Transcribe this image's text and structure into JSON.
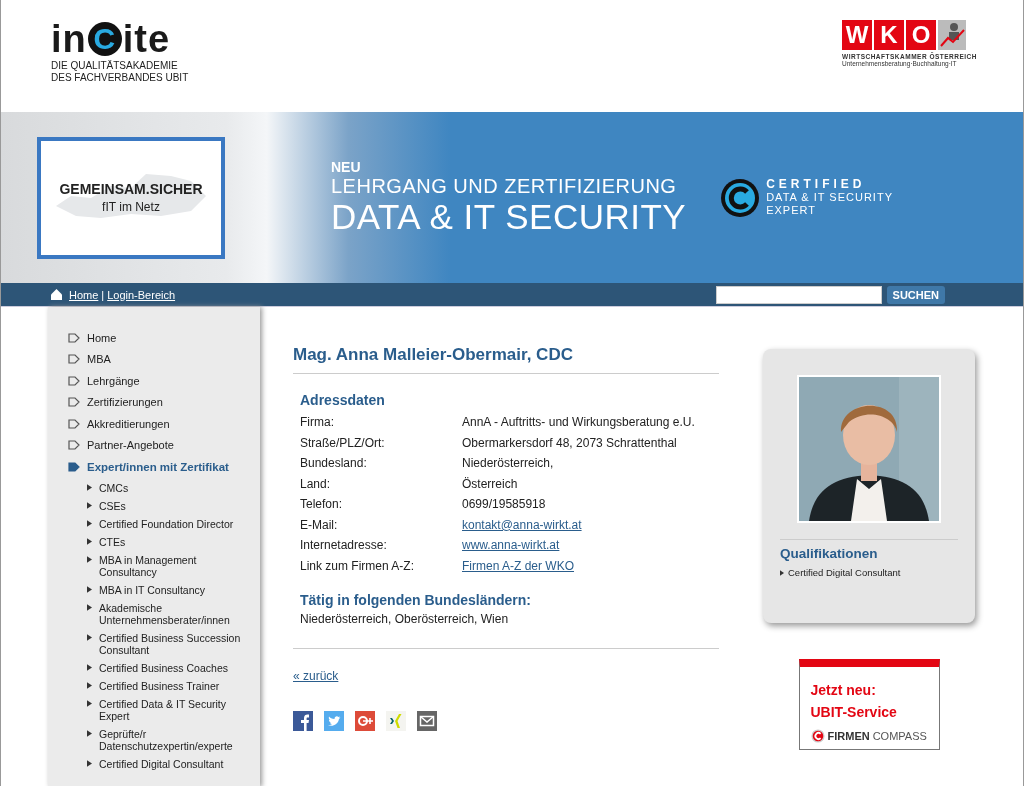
{
  "header": {
    "logo": {
      "parts": [
        "in",
        "C",
        "ite"
      ],
      "tagline": [
        "DIE QUALITÄTSAKADEMIE",
        "DES FACHVERBANDES UBIT"
      ]
    },
    "partner_logo": {
      "letters": [
        "W",
        "K",
        "O"
      ],
      "line1": "WIRTSCHAFTSKAMMER ÖSTERREICH",
      "line2": "Unternehmensberatung·Buchhaltung·IT"
    }
  },
  "banner": {
    "badge_title": "GEMEINSAM.SICHER",
    "badge_subtitle": "fIT im Netz",
    "kicker": "NEU",
    "subtitle": "LEHRGANG UND ZERTIFIZIERUNG",
    "title": "DATA & IT SECURITY",
    "cert": [
      "CERTIFIED",
      "DATA & IT SECURITY",
      "EXPERT"
    ]
  },
  "breadcrumb": {
    "links": [
      "Home",
      "Login-Bereich"
    ],
    "separator": "|"
  },
  "search": {
    "button": "SUCHEN"
  },
  "sidebar": {
    "items": [
      {
        "label": "Home",
        "selected": false
      },
      {
        "label": "MBA",
        "selected": false
      },
      {
        "label": "Lehrgänge",
        "selected": false
      },
      {
        "label": "Zertifizierungen",
        "selected": false
      },
      {
        "label": "Akkreditierungen",
        "selected": false
      },
      {
        "label": "Partner-Angebote",
        "selected": false
      },
      {
        "label": "Expert/innen mit Zertifikat",
        "selected": true,
        "children": [
          "CMCs",
          "CSEs",
          "Certified Foundation Director",
          "CTEs",
          "MBA in Management Consultancy",
          "MBA in IT Consultancy",
          "Akademische Unternehmensberater/innen",
          "Certified Business Succession Consultant",
          "Certified Business Coaches",
          "Certified Business Trainer",
          "Certified Data & IT Security Expert",
          "Geprüfte/r Datenschutzexpertin/experte",
          "Certified Digital Consultant"
        ]
      }
    ]
  },
  "profile": {
    "name": "Mag. Anna Malleier-Obermair, CDC",
    "section": "Adressdaten",
    "fields": [
      {
        "label": "Firma:",
        "value": "AnnA - Auftritts- und Wirkungsberatung e.U.",
        "kind": "text"
      },
      {
        "label": "Straße/PLZ/Ort:",
        "value": "Obermarkersdorf 48, 2073 Schrattenthal",
        "kind": "text"
      },
      {
        "label": "Bundesland:",
        "value": "Niederösterreich,",
        "kind": "text"
      },
      {
        "label": "Land:",
        "value": "Österreich",
        "kind": "text"
      },
      {
        "label": "Telefon:",
        "value": "0699/19585918",
        "kind": "text"
      },
      {
        "label": "E-Mail:",
        "value": "kontakt@anna-wirkt.at",
        "kind": "link"
      },
      {
        "label": "Internetadresse:",
        "value": "www.anna-wirkt.at",
        "kind": "link"
      },
      {
        "label": "Link zum Firmen A-Z:",
        "value": "Firmen A-Z der WKO",
        "kind": "link"
      }
    ],
    "regions_heading": "Tätig in folgenden Bundesländern:",
    "regions": "Niederösterreich, Oberösterreich, Wien",
    "back_link": "« zurück",
    "share": [
      {
        "kind": "facebook"
      },
      {
        "kind": "twitter"
      },
      {
        "kind": "googleplus"
      },
      {
        "kind": "xing"
      },
      {
        "kind": "email"
      }
    ]
  },
  "card": {
    "photo": {
      "kind": "picture"
    },
    "heading": "Qualifikationen",
    "items": [
      "Certified Digital Consultant"
    ]
  },
  "promo": {
    "line1": "Jetzt neu:",
    "line2": "UBIT-Service",
    "brand_bold": "FIRMEN",
    "brand_light": "COMPASS"
  }
}
